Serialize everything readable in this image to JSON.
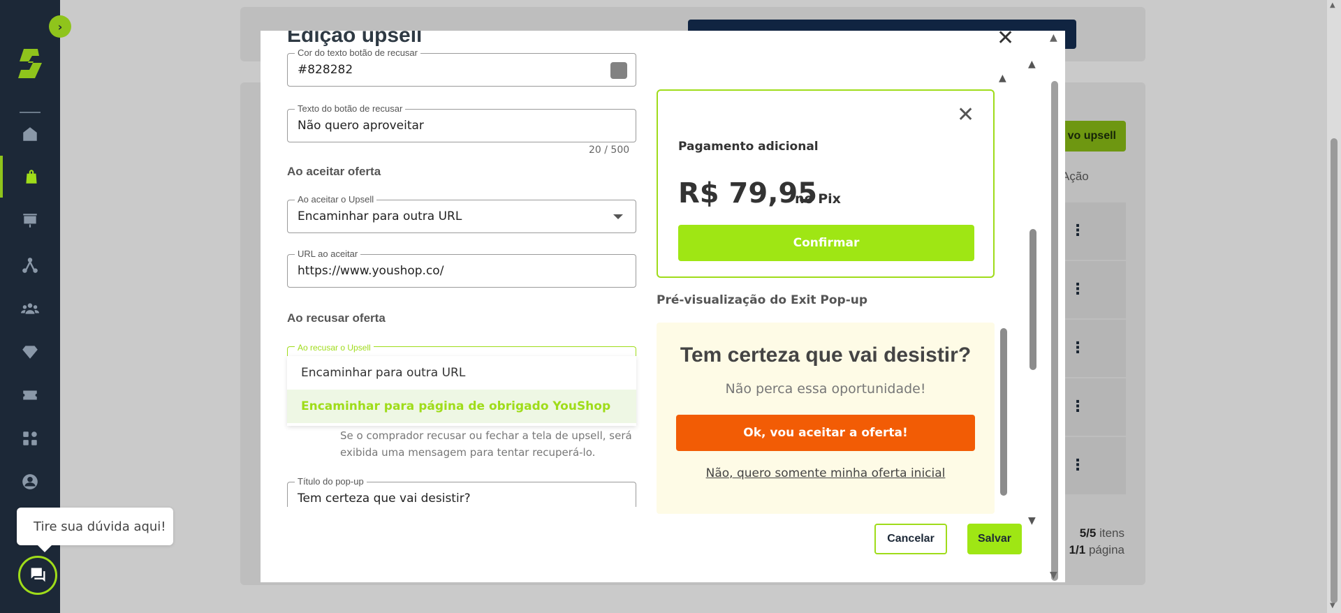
{
  "sidebar": {
    "toggle_icon": "›",
    "nav": [
      {
        "name": "home-icon"
      },
      {
        "name": "shopping-bag-icon",
        "active": true
      },
      {
        "name": "presentation-chart-icon"
      },
      {
        "name": "network-icon"
      },
      {
        "name": "users-icon"
      },
      {
        "name": "diamond-icon"
      },
      {
        "name": "ticket-icon"
      },
      {
        "name": "apps-grid-icon"
      },
      {
        "name": "account-icon"
      }
    ]
  },
  "background": {
    "new_button": "vo upsell",
    "action_header": "Ação",
    "items_count": "5/5",
    "items_label": "itens",
    "page_count": "1/1",
    "page_label": "página"
  },
  "modal": {
    "title": "Edição upsell",
    "fields": {
      "decline_color": {
        "label": "Cor do texto botão de recusar",
        "value": "#828282"
      },
      "decline_text": {
        "label": "Texto do botão de recusar",
        "value": "Não quero aproveitar",
        "counter": "20 / 500"
      },
      "on_accept": {
        "label": "Ao aceitar o Upsell",
        "value": "Encaminhar para outra URL"
      },
      "accept_url": {
        "label": "URL ao aceitar",
        "value": "https://www.youshop.co/"
      },
      "on_decline": {
        "label": "Ao recusar o Upsell"
      },
      "popup_title": {
        "label": "Título do pop-up",
        "value": "Tem certeza que vai desistir?"
      }
    },
    "sections": {
      "accept": "Ao aceitar oferta",
      "decline": "Ao recusar oferta"
    },
    "dropdown": {
      "options": [
        "Encaminhar para outra URL",
        "Encaminhar para página de obrigado YouShop"
      ]
    },
    "helper_text": "Se o comprador recusar ou fechar a tela de upsell, será exibida uma mensagem para tentar recuperá-lo.",
    "upsell_preview": {
      "title": "Pagamento adicional",
      "price": "R$ 79,95",
      "method": "no Pix",
      "confirm": "Confirmar"
    },
    "exit_preview_title": "Pré-visualização do Exit Pop-up",
    "exit_popup": {
      "heading": "Tem certeza que vai desistir?",
      "subheading": "Não perca essa oportunidade!",
      "accept": "Ok, vou aceitar a oferta!",
      "decline": "Não, quero somente minha oferta inicial"
    },
    "buttons": {
      "cancel": "Cancelar",
      "save": "Salvar"
    }
  },
  "help": {
    "tooltip": "Tire sua dúvida aqui!"
  },
  "colors": {
    "accent": "#9fdc1a",
    "sidebar": "#1c2837",
    "exit_accept": "#f25c05",
    "swatch": "#828282"
  }
}
